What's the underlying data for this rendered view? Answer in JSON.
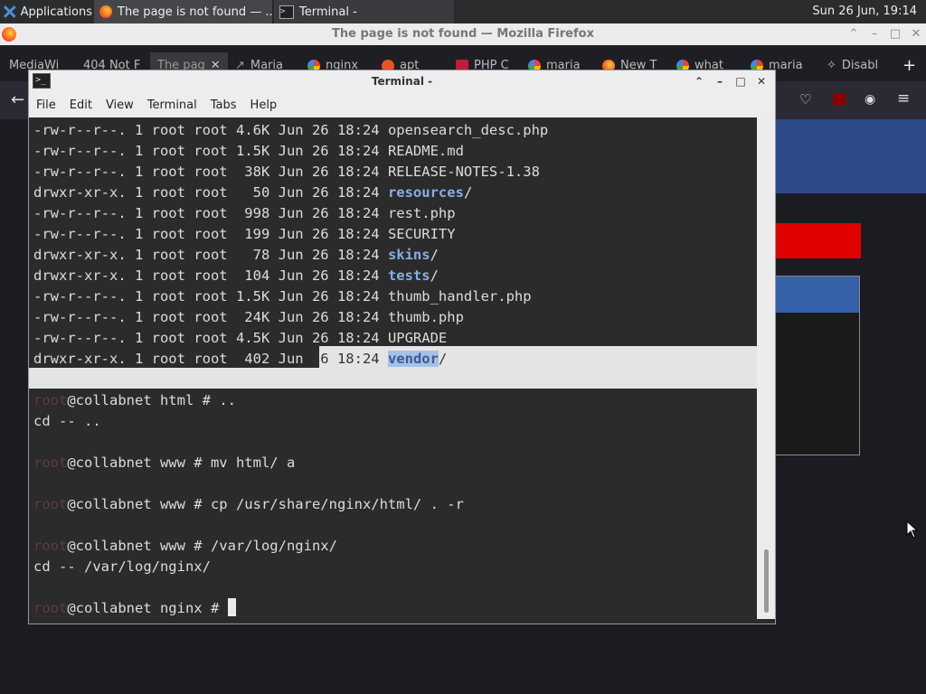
{
  "panel": {
    "apps_label": "Applications",
    "tasks": [
      {
        "label": "The page is not found — ..."
      },
      {
        "label": "Terminal -"
      }
    ],
    "clock": "Sun 26 Jun, 19:14"
  },
  "firefox": {
    "window_title": "The page is not found — Mozilla Firefox",
    "tabs": [
      {
        "label": "MediaWi"
      },
      {
        "label": "404 Not F"
      },
      {
        "label": "The pag"
      },
      {
        "label": "Maria"
      },
      {
        "label": "nginx"
      },
      {
        "label": "apt"
      },
      {
        "label": "PHP C"
      },
      {
        "label": "maria"
      },
      {
        "label": "New T"
      },
      {
        "label": "what"
      },
      {
        "label": "maria"
      },
      {
        "label": "Disabl"
      }
    ],
    "new_tab_symbol": "+"
  },
  "terminal": {
    "title": "Terminal -",
    "menu": [
      "File",
      "Edit",
      "View",
      "Terminal",
      "Tabs",
      "Help"
    ],
    "listing": [
      {
        "perm": "-rw-r--r--.",
        "links": "1",
        "owner": "root",
        "group": "root",
        "size": "4.6K",
        "date": "Jun 26 18:24",
        "name": "opensearch_desc.php",
        "is_dir": false
      },
      {
        "perm": "-rw-r--r--.",
        "links": "1",
        "owner": "root",
        "group": "root",
        "size": "1.5K",
        "date": "Jun 26 18:24",
        "name": "README.md",
        "is_dir": false
      },
      {
        "perm": "-rw-r--r--.",
        "links": "1",
        "owner": "root",
        "group": "root",
        "size": "38K",
        "date": "Jun 26 18:24",
        "name": "RELEASE-NOTES-1.38",
        "is_dir": false
      },
      {
        "perm": "drwxr-xr-x.",
        "links": "1",
        "owner": "root",
        "group": "root",
        "size": "50",
        "date": "Jun 26 18:24",
        "name": "resources",
        "is_dir": true
      },
      {
        "perm": "-rw-r--r--.",
        "links": "1",
        "owner": "root",
        "group": "root",
        "size": "998",
        "date": "Jun 26 18:24",
        "name": "rest.php",
        "is_dir": false
      },
      {
        "perm": "-rw-r--r--.",
        "links": "1",
        "owner": "root",
        "group": "root",
        "size": "199",
        "date": "Jun 26 18:24",
        "name": "SECURITY",
        "is_dir": false
      },
      {
        "perm": "drwxr-xr-x.",
        "links": "1",
        "owner": "root",
        "group": "root",
        "size": "78",
        "date": "Jun 26 18:24",
        "name": "skins",
        "is_dir": true
      },
      {
        "perm": "drwxr-xr-x.",
        "links": "1",
        "owner": "root",
        "group": "root",
        "size": "104",
        "date": "Jun 26 18:24",
        "name": "tests",
        "is_dir": true
      },
      {
        "perm": "-rw-r--r--.",
        "links": "1",
        "owner": "root",
        "group": "root",
        "size": "1.5K",
        "date": "Jun 26 18:24",
        "name": "thumb_handler.php",
        "is_dir": false
      },
      {
        "perm": "-rw-r--r--.",
        "links": "1",
        "owner": "root",
        "group": "root",
        "size": "24K",
        "date": "Jun 26 18:24",
        "name": "thumb.php",
        "is_dir": false
      },
      {
        "perm": "-rw-r--r--.",
        "links": "1",
        "owner": "root",
        "group": "root",
        "size": "4.5K",
        "date": "Jun 26 18:24",
        "name": "UPGRADE",
        "is_dir": false
      }
    ],
    "last_row": {
      "left": "drwxr-xr-x. 1 root root  402 Jun",
      "middle": " 26 18:24 ",
      "name": "vendor",
      "suffix": "/"
    },
    "session": [
      {
        "prompt_user": "root",
        "prompt_host": "@collabnet html # ",
        "command": ".."
      },
      {
        "output": "cd -- .."
      },
      {
        "prompt_user": "root",
        "prompt_host": "@collabnet www # ",
        "command": "mv html/ a"
      },
      {
        "prompt_user": "root",
        "prompt_host": "@collabnet www # ",
        "command": "cp /usr/share/nginx/html/ . -r"
      },
      {
        "prompt_user": "root",
        "prompt_host": "@collabnet www # ",
        "command": "/var/log/nginx/"
      },
      {
        "output": "cd -- /var/log/nginx/"
      },
      {
        "prompt_user": "root",
        "prompt_host": "@collabnet nginx # ",
        "command": ""
      }
    ]
  }
}
